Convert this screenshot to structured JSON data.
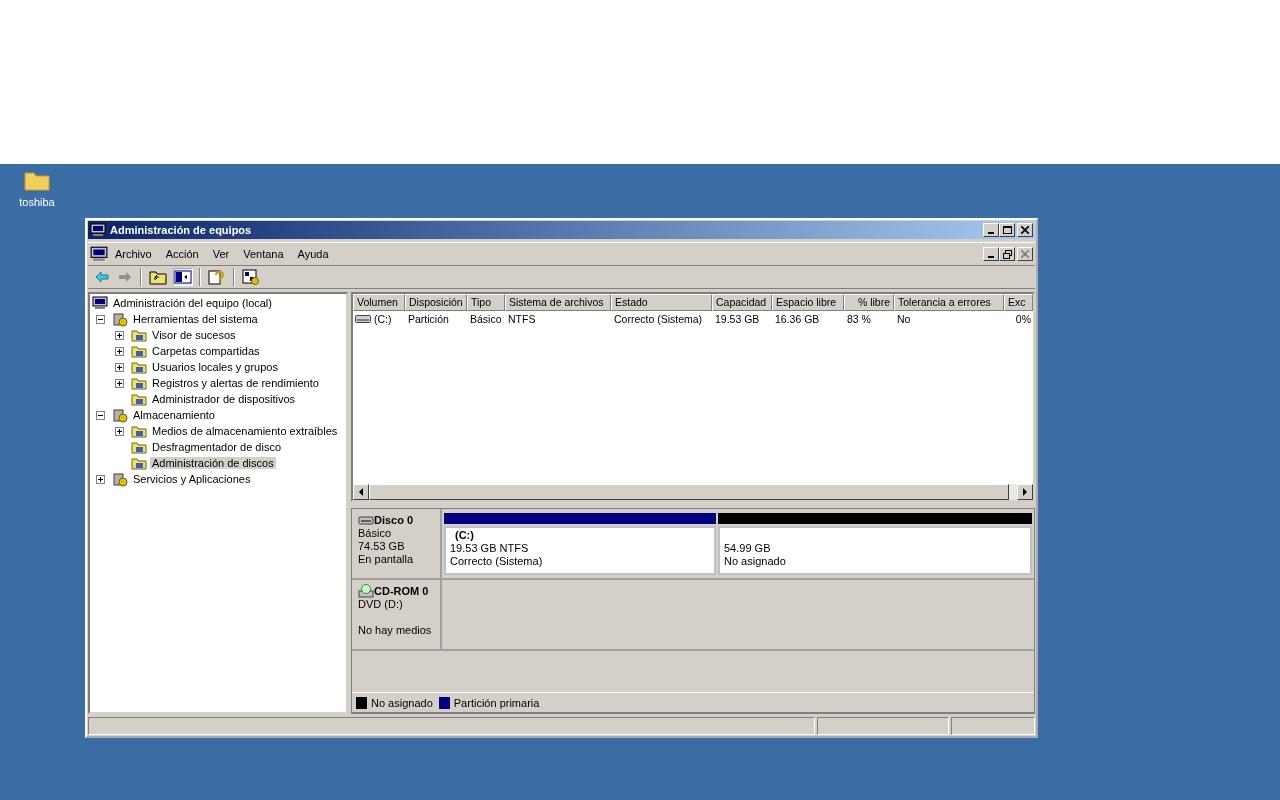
{
  "desktop": {
    "icons": [
      {
        "label": "toshiba"
      }
    ]
  },
  "window": {
    "title": "Administración de equipos"
  },
  "menu": [
    "Archivo",
    "Acción",
    "Ver",
    "Ventana",
    "Ayuda"
  ],
  "tree": [
    {
      "label": "Administración del equipo (local)",
      "selected": false,
      "children": [
        {
          "label": "Herramientas del sistema",
          "expanded": true,
          "selected": false,
          "children": [
            {
              "label": "Visor de sucesos",
              "expanded": false,
              "selected": false
            },
            {
              "label": "Carpetas compartidas",
              "expanded": false,
              "selected": false
            },
            {
              "label": "Usuarios locales y grupos",
              "expanded": false,
              "selected": false
            },
            {
              "label": "Registros y alertas de rendimiento",
              "expanded": false,
              "selected": false
            },
            {
              "label": "Administrador de dispositivos",
              "selected": false
            }
          ]
        },
        {
          "label": "Almacenamiento",
          "expanded": true,
          "selected": false,
          "children": [
            {
              "label": "Medios de almacenamiento extraíbles",
              "expanded": false,
              "selected": false
            },
            {
              "label": "Desfragmentador de disco",
              "selected": false
            },
            {
              "label": "Administración de discos",
              "selected": true
            }
          ]
        },
        {
          "label": "Servicios y Aplicaciones",
          "expanded": false,
          "selected": false
        }
      ]
    }
  ],
  "volumes": {
    "columns": [
      "Volumen",
      "Disposición",
      "Tipo",
      "Sistema de archivos",
      "Estado",
      "Capacidad",
      "Espacio libre",
      "% libre",
      "Tolerancia a errores",
      "Exc"
    ],
    "rows": [
      [
        "(C:)",
        "Partición",
        "Básico",
        "NTFS",
        "Correcto (Sistema)",
        "19.53 GB",
        "16.36 GB",
        "83 %",
        "No",
        "0%"
      ]
    ]
  },
  "disks": [
    {
      "name": "Disco 0",
      "kind": "disk",
      "lines": [
        "Básico",
        "74.53 GB",
        "En pantalla"
      ],
      "partitions": [
        {
          "name": "(C:)",
          "size": "19.53 GB NTFS",
          "status": "Correcto (Sistema)",
          "color": "#000080"
        },
        {
          "size": "54.99 GB",
          "status": "No asignado",
          "color": "#000000"
        }
      ]
    },
    {
      "name": "CD-ROM 0",
      "kind": "cdrom",
      "lines": [
        "DVD (D:)",
        "No hay medios"
      ]
    }
  ],
  "legend": [
    {
      "label": "No asignado",
      "color": "#000000"
    },
    {
      "label": "Partición primaria",
      "color": "#000080"
    }
  ]
}
